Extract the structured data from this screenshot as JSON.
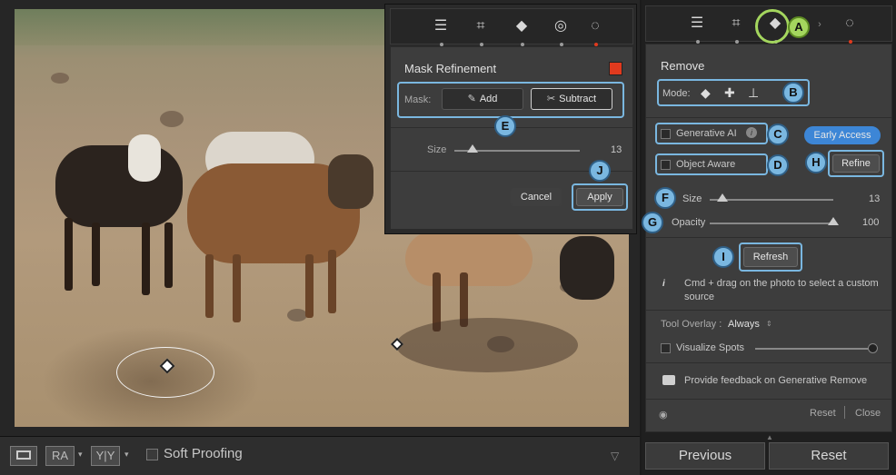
{
  "bottom_bar": {
    "view_single": "",
    "view_ra": "RA",
    "view_yy": "Y|Y",
    "soft_proofing_label": "Soft Proofing"
  },
  "tool_strip": {
    "icons": [
      "sliders-icon",
      "crop-icon",
      "eraser-icon",
      "redeye-icon",
      "masking-icon"
    ]
  },
  "remove_panel": {
    "title": "Remove",
    "mode_label": "Mode:",
    "generative_ai_label": "Generative AI",
    "early_access_label": "Early Access",
    "object_aware_label": "Object Aware",
    "refine_label": "Refine",
    "size_label": "Size",
    "size_value": "13",
    "opacity_label": "Opacity",
    "opacity_value": "100",
    "refresh_label": "Refresh",
    "hint_text": "Cmd + drag on the photo to select a custom source",
    "tool_overlay_label": "Tool Overlay :",
    "tool_overlay_value": "Always",
    "visualize_spots_label": "Visualize Spots",
    "feedback_label": "Provide feedback on Generative Remove",
    "reset_label": "Reset",
    "close_label": "Close",
    "size_fraction": 0.1,
    "opacity_fraction": 1.0
  },
  "footer": {
    "previous_label": "Previous",
    "reset_label": "Reset"
  },
  "mask_popup": {
    "title": "Mask Refinement",
    "mask_label": "Mask:",
    "add_label": "Add",
    "subtract_label": "Subtract",
    "size_label": "Size",
    "size_value": "13",
    "cancel_label": "Cancel",
    "apply_label": "Apply",
    "swatch_color": "#e03a1e"
  },
  "callouts": {
    "a": "A",
    "b": "B",
    "c": "C",
    "d": "D",
    "e": "E",
    "f": "F",
    "g": "G",
    "h": "H",
    "i": "I",
    "j": "J"
  },
  "colors": {
    "accent_blue": "#3d86d6",
    "highlight": "#7ab7e0",
    "callout_green": "#a4d65e"
  }
}
